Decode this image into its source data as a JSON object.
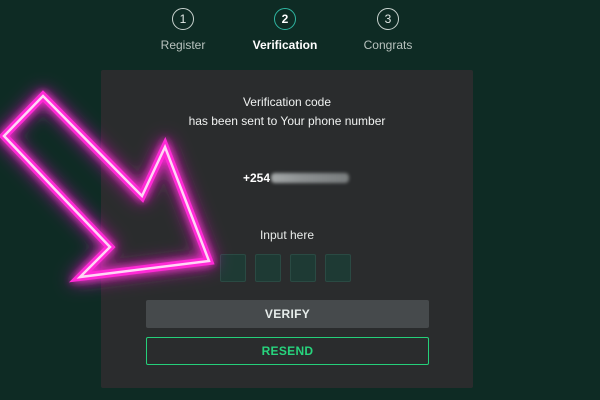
{
  "stepper": {
    "steps": [
      {
        "number": "1",
        "label": "Register"
      },
      {
        "number": "2",
        "label": "Verification"
      },
      {
        "number": "3",
        "label": "Congrats"
      }
    ],
    "active_step": 2
  },
  "card": {
    "message_line1": "Verification code",
    "message_line2": "has been sent to Your phone number",
    "phone_prefix": "+254",
    "input_label": "Input here",
    "code_boxes": [
      "",
      "",
      "",
      ""
    ],
    "verify_label": "VERIFY",
    "resend_label": "RESEND"
  },
  "colors": {
    "background": "#0e2b24",
    "card": "#2a2c2d",
    "accent_green": "#27d47d",
    "arrow_neon": "#ff2bd6"
  }
}
